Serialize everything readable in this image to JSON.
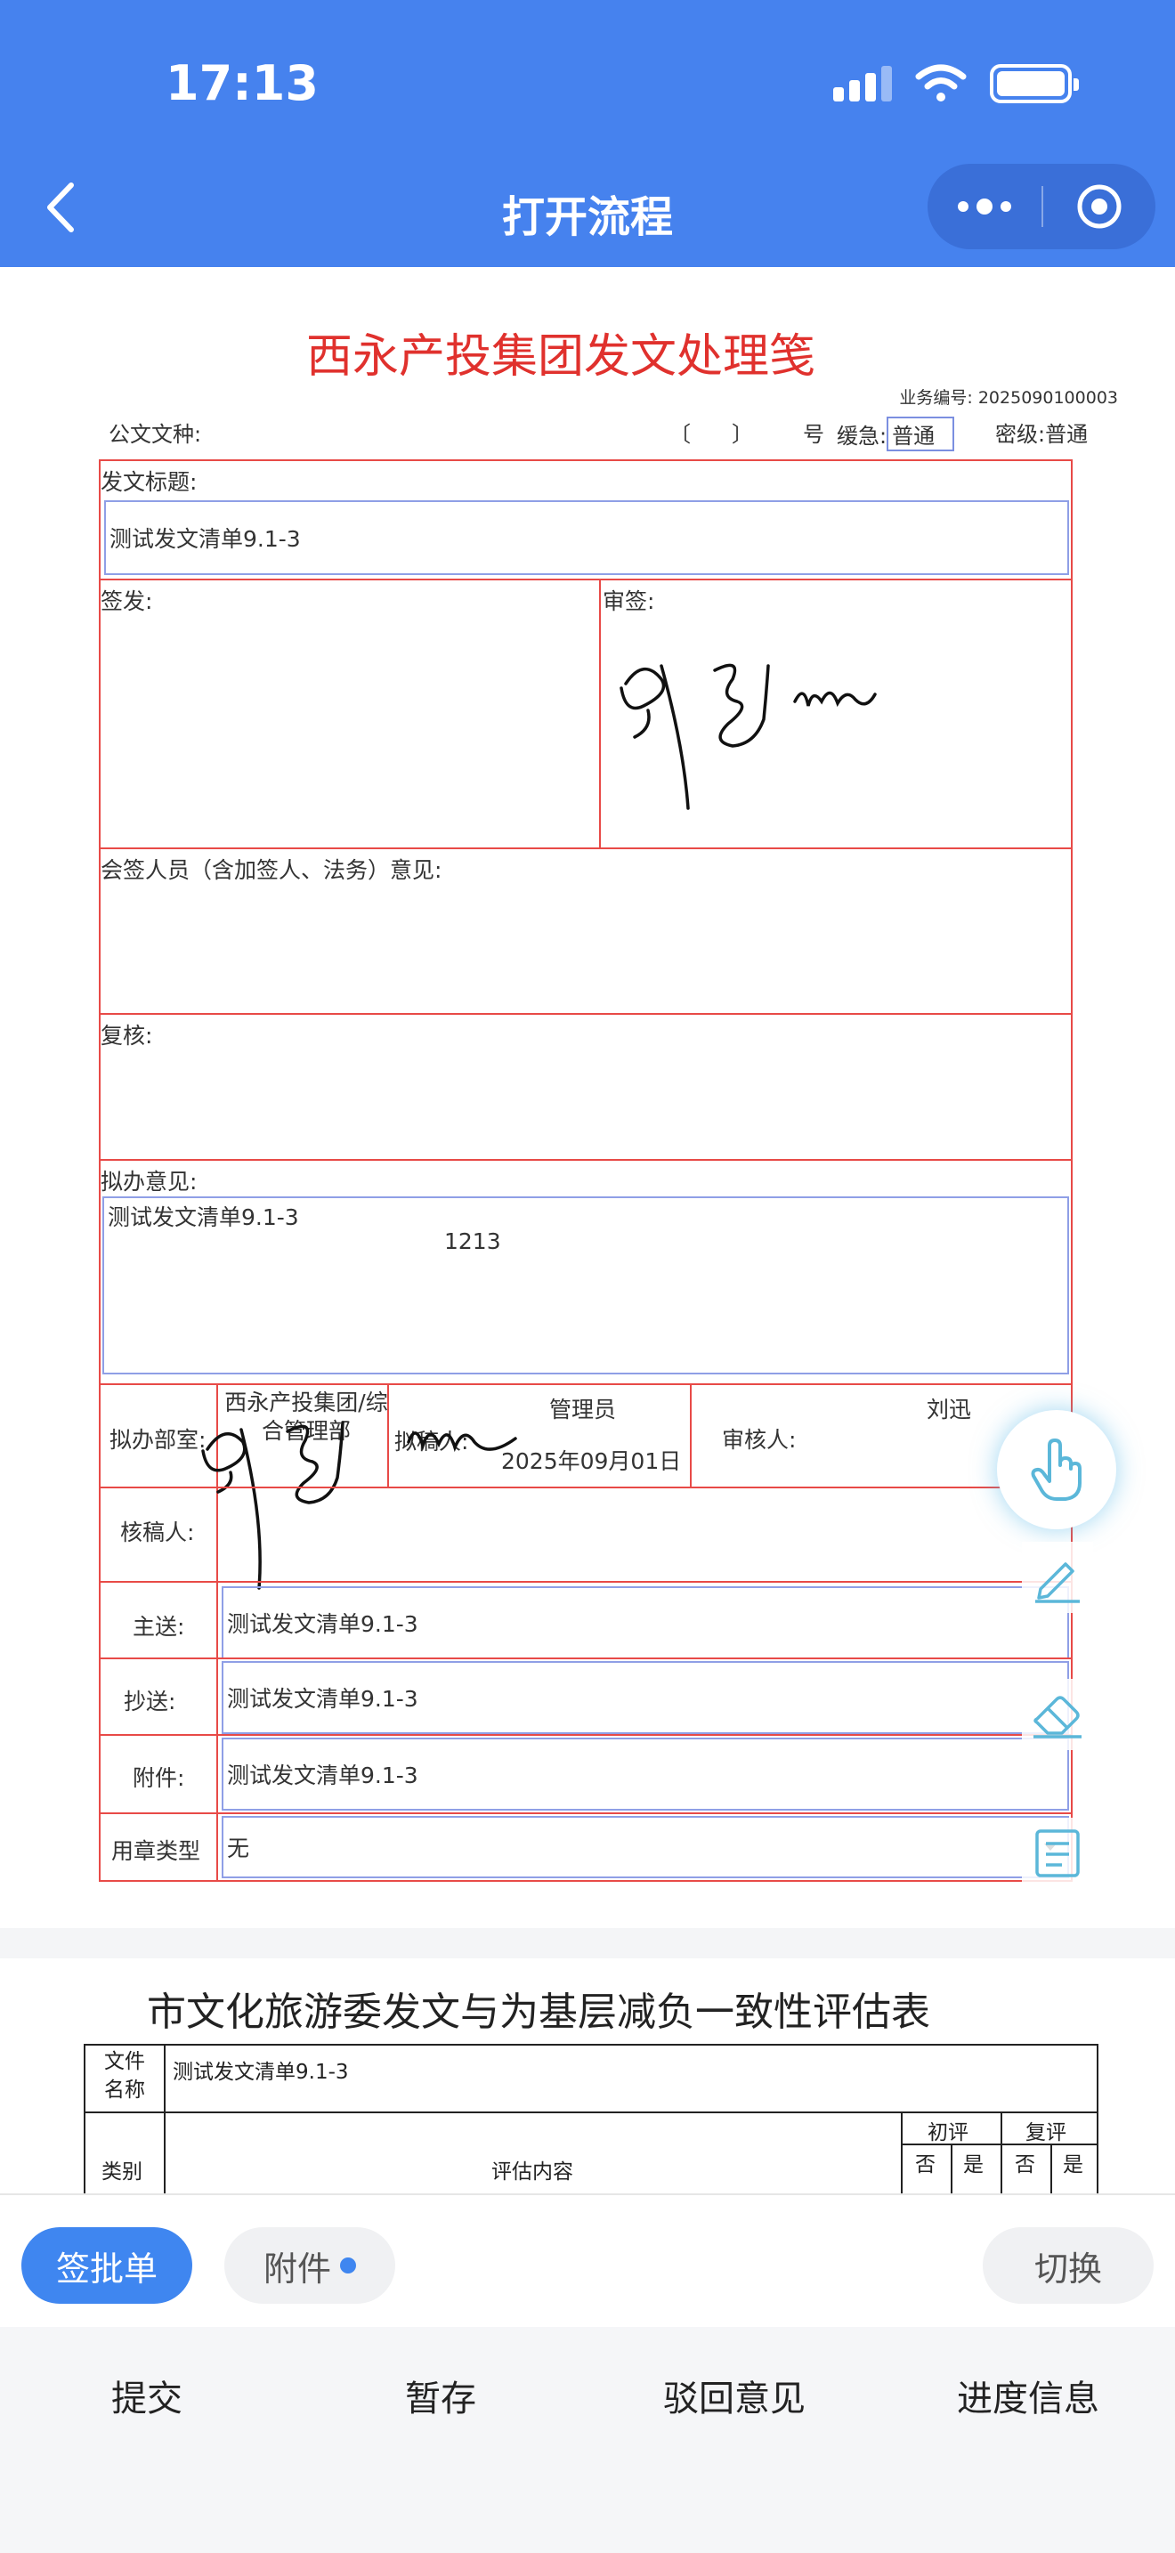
{
  "status_bar": {
    "time": "17:13"
  },
  "nav": {
    "title": "打开流程"
  },
  "form": {
    "title": "西永产投集团发文处理笺",
    "business_no_label": "业务编号:",
    "business_no": "2025090100003",
    "doc_type_label": "公文文种:",
    "doc_no_bracket_open": "〔",
    "doc_no_bracket_close": "〕",
    "doc_no_label": "号",
    "urgency_label": "缓急:",
    "urgency_value": "普通",
    "secret_label": "密级:",
    "secret_value": "普通",
    "subject_label": "发文标题:",
    "subject_value": "测试发文清单9.1-3",
    "issue_label": "签发:",
    "review_label": "审签:",
    "countersign_label": "会签人员（含加签人、法务）意见:",
    "recheck_label": "复核:",
    "opinion_label": "拟办意见:",
    "opinion_value": "测试发文清单9.1-3",
    "opinion_extra": "1213",
    "dept_label": "拟办部室:",
    "dept_value": "西永产投集团/综合管理部",
    "drafter_label": "拟稿人:",
    "drafter_name": "管理员",
    "drafter_date": "2025年09月01日",
    "auditor_label": "审核人:",
    "auditor_name": "刘迅",
    "checker_label": "核稿人:",
    "main_send_label": "主送:",
    "main_send_value": "测试发文清单9.1-3",
    "cc_label": "抄送:",
    "cc_value": "测试发文清单9.1-3",
    "attachment_label": "附件:",
    "attachment_value": "测试发文清单9.1-3",
    "seal_label": "用章类型",
    "seal_value": "无"
  },
  "form2": {
    "title": "市文化旅游委发文与为基层减负一致性评估表",
    "file_name_label_1": "文件",
    "file_name_label_2": "名称",
    "file_name_value": "测试发文清单9.1-3",
    "category_label": "类别",
    "content_label": "评估内容",
    "initial_label": "初评",
    "review_label": "复评",
    "no_1": "否",
    "yes_1": "是",
    "no_2": "否",
    "yes_2": "是"
  },
  "tabs": {
    "approval": "签批单",
    "attachments": "附件",
    "switch": "切换"
  },
  "actions": {
    "submit": "提交",
    "save": "暂存",
    "reject": "驳回意见",
    "progress": "进度信息"
  },
  "colors": {
    "header_blue": "#4682ee",
    "form_red": "#e84a47",
    "title_red": "#e0312d",
    "input_border": "#8f9fe6",
    "active_tab": "#3f86f0"
  }
}
